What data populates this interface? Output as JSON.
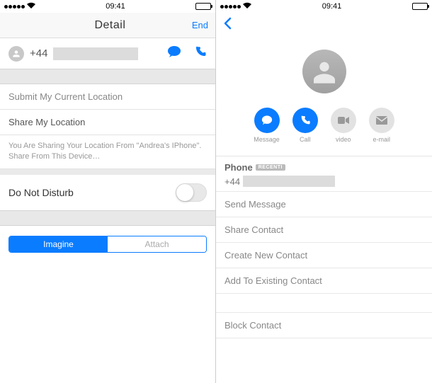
{
  "status": {
    "time": "09:41"
  },
  "left": {
    "nav_title": "Detail",
    "nav_right": "End",
    "phone_prefix": "+44",
    "submit_location": "Submit My Current Location",
    "share_location": "Share My Location",
    "share_note": "You Are Sharing Your Location From \"Andrea's IPhone\". Share From This Device…",
    "dnd": "Do Not Disturb",
    "seg_a": "Imagine",
    "seg_b": "Attach"
  },
  "right": {
    "actions": {
      "message": "Message",
      "call": "Call",
      "video": "video",
      "email": "e-mail"
    },
    "phone_label": "Phone",
    "phone_badge": "RECENTI",
    "phone_prefix": "+44",
    "links": {
      "send": "Send Message",
      "share": "Share Contact",
      "create": "Create New Contact",
      "add": "Add To Existing Contact",
      "block": "Block Contact"
    }
  }
}
